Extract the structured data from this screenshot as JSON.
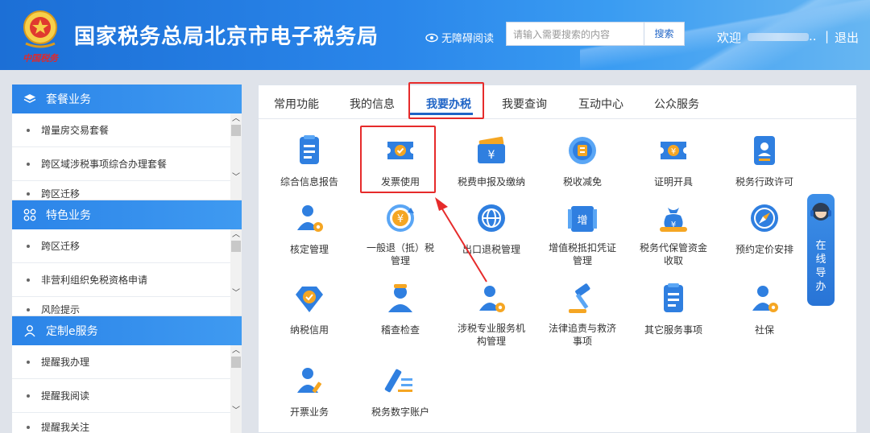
{
  "header": {
    "emblem_text": "中国税务",
    "title": "国家税务总局北京市电子税务局",
    "accessibility": "无障碍阅读",
    "search_placeholder": "请输入需要搜索的内容",
    "search_button": "搜索",
    "welcome": "欢迎",
    "user_suffix": "..",
    "separator": "|",
    "logout": "退出"
  },
  "sidebar": [
    {
      "title": "套餐业务",
      "icon": "layers-icon",
      "items": [
        "增量房交易套餐",
        "跨区域涉税事项综合办理套餐",
        "跨区迁移"
      ]
    },
    {
      "title": "特色业务",
      "icon": "grid-icon",
      "items": [
        "跨区迁移",
        "非营利组织免税资格申请",
        "风险提示"
      ]
    },
    {
      "title": "定制e服务",
      "icon": "user-icon",
      "items": [
        "提醒我办理",
        "提醒我阅读",
        "提醒我关注"
      ]
    }
  ],
  "tabs": [
    "常用功能",
    "我的信息",
    "我要办税",
    "我要查询",
    "互动中心",
    "公众服务"
  ],
  "active_tab": "我要办税",
  "services": [
    [
      "综合信息报告",
      "发票使用",
      "税费申报及缴纳",
      "税收减免",
      "证明开具",
      "税务行政许可"
    ],
    [
      "核定管理",
      "一般退（抵）税管理",
      "出口退税管理",
      "增值税抵扣凭证管理",
      "税务代保管资金收取",
      "预约定价安排"
    ],
    [
      "纳税信用",
      "稽查检查",
      "涉税专业服务机构管理",
      "法律追责与救济事项",
      "其它服务事项",
      "社保"
    ],
    [
      "开票业务",
      "税务数字账户"
    ]
  ],
  "icon_names": [
    [
      "doc-list-icon",
      "ticket-check-icon",
      "yuan-card-icon",
      "shield-coin-icon",
      "yuan-ticket-icon",
      "id-badge-icon"
    ],
    [
      "user-gear-icon",
      "yuan-cycle-icon",
      "globe-icon",
      "vat-ticket-icon",
      "money-bag-icon",
      "compass-icon"
    ],
    [
      "diamond-check-icon",
      "inspector-icon",
      "user-gear-icon",
      "gavel-icon",
      "doc-list-icon",
      "user-gear-icon"
    ],
    [
      "user-pen-icon",
      "pen-lines-icon"
    ]
  ],
  "guide": {
    "label": "在线导办"
  },
  "colors": {
    "primary": "#1f64c6",
    "highlight": "#e62b2b",
    "header": "#2a86ea"
  }
}
